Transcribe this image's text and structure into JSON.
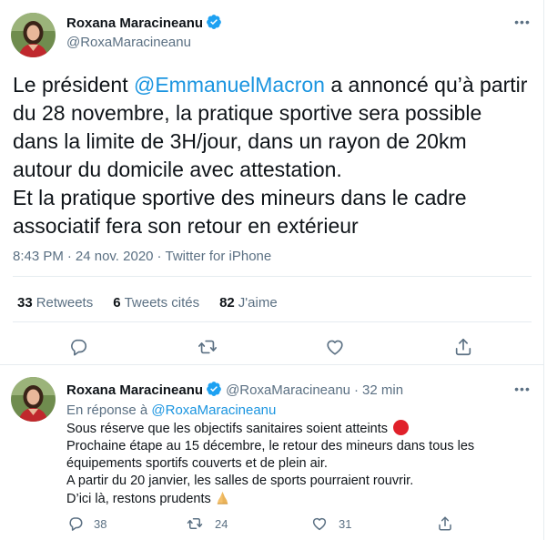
{
  "main_tweet": {
    "author_name": "Roxana Maracineanu",
    "author_handle": "@RoxaMaracineanu",
    "body_before_mention": "Le président ",
    "mention": "@EmmanuelMacron",
    "body_after_mention": " a annoncé qu’à partir du 28 novembre, la pratique sportive sera possible dans la limite de 3H/jour, dans un rayon de 20km autour du domicile avec attestation.\nEt la pratique sportive des mineurs dans le cadre associatif fera son retour en extérieur",
    "time": "8:43 PM",
    "date": "24 nov. 2020",
    "source": "Twitter for iPhone",
    "separator": "·",
    "stats": {
      "retweets_count": "33",
      "retweets_label": "Retweets",
      "quotes_count": "6",
      "quotes_label": "Tweets cités",
      "likes_count": "82",
      "likes_label": "J'aime"
    }
  },
  "reply_tweet": {
    "author_name": "Roxana Maracineanu",
    "author_handle": "@RoxaMaracineanu",
    "separator": "·",
    "time_ago": "32 min",
    "reply_to_label": "En réponse à",
    "reply_to_handle": "@RoxaMaracineanu",
    "body_line1": "Sous réserve que les objectifs sanitaires soient atteints",
    "body_rest": "Prochaine étape au 15 décembre, le retour des mineurs dans tous les équipements sportifs couverts et de plein air.\nA partir du 20 janvier, les salles de sports pourraient rouvrir.\nD’ici là, restons prudents",
    "reply_count": "38",
    "retweet_count": "24",
    "like_count": "31"
  },
  "colors": {
    "accent": "#1b95e0",
    "verified": "#1da1f2",
    "secondary_text": "#5b7083",
    "border": "#e6ecf0",
    "red_dot": "#e0202a"
  },
  "icons": [
    "verified-badge-icon",
    "more-icon",
    "reply-icon",
    "retweet-icon",
    "like-icon",
    "share-icon",
    "red-circle-emoji",
    "folded-hands-emoji"
  ]
}
